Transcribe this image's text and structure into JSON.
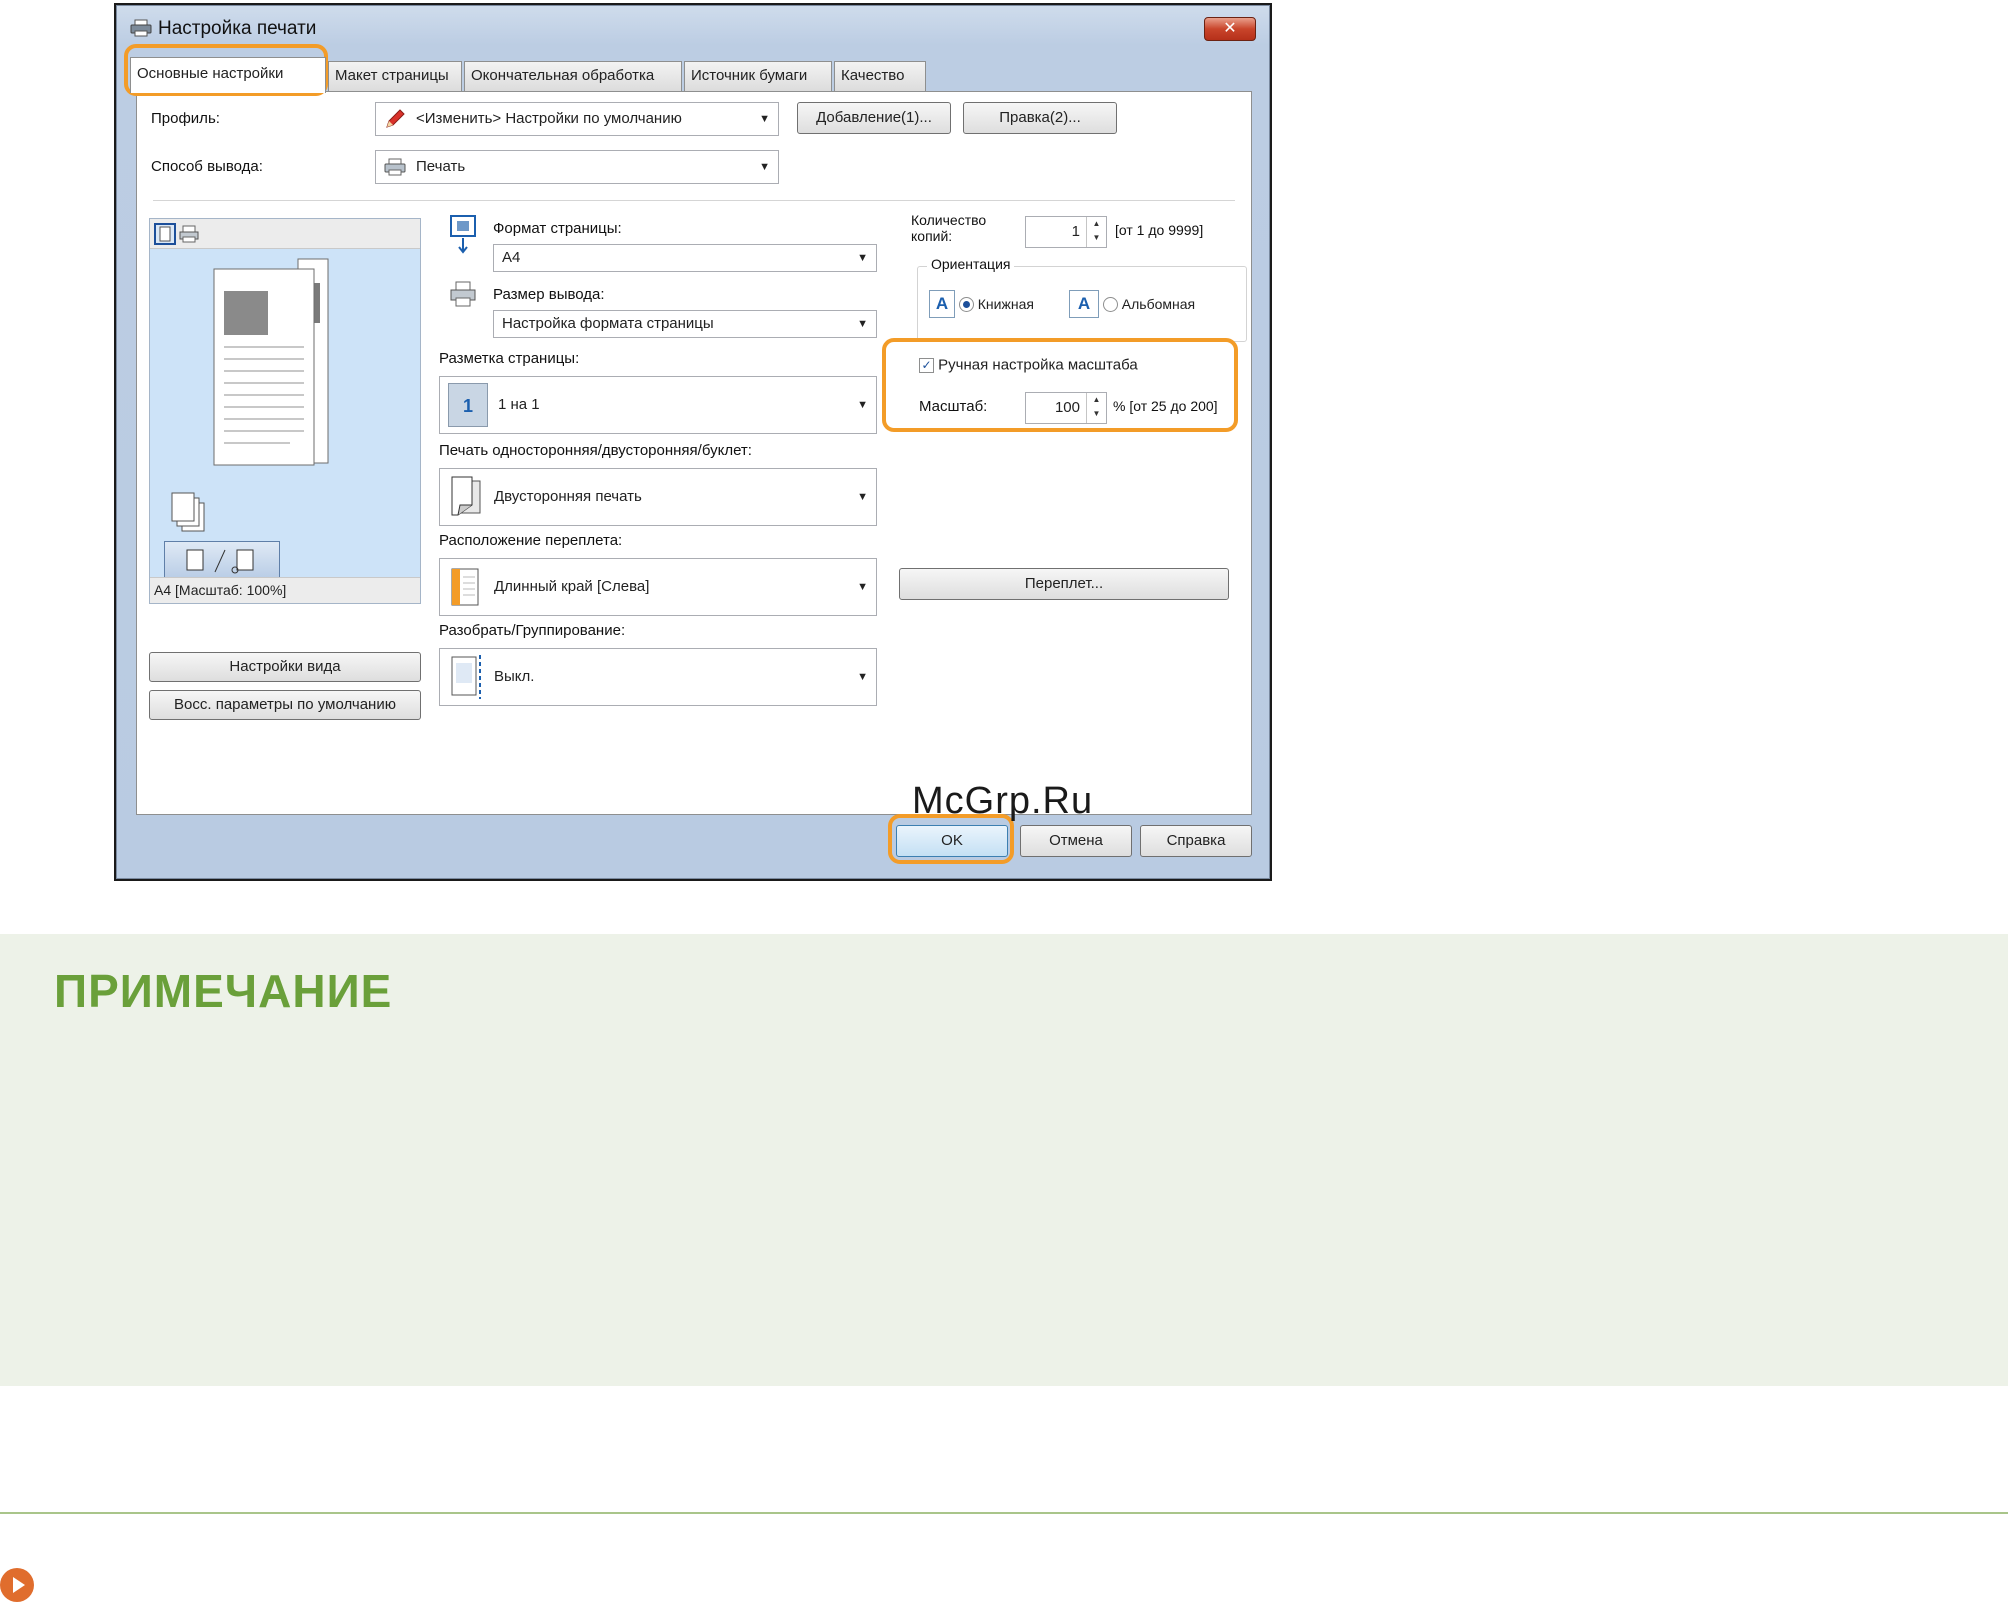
{
  "dialog": {
    "title": "Настройка печати",
    "close_glyph": "✕"
  },
  "tabs": [
    {
      "label": "Основные настройки"
    },
    {
      "label": "Макет страницы"
    },
    {
      "label": "Окончательная обработка"
    },
    {
      "label": "Источник бумаги"
    },
    {
      "label": "Качество"
    }
  ],
  "profile": {
    "label": "Профиль:",
    "value": "<Изменить> Настройки по умолчанию",
    "add_button": "Добавление(1)...",
    "edit_button": "Правка(2)..."
  },
  "output_method": {
    "label": "Способ вывода:",
    "value": "Печать"
  },
  "preview": {
    "status": "A4 [Масштаб: 100%]",
    "view_settings_button": "Настройки вида",
    "restore_defaults_button": "Восс. параметры по умолчанию"
  },
  "page_size": {
    "label": "Формат страницы:",
    "value": "A4"
  },
  "output_size": {
    "label": "Размер вывода:",
    "value": "Настройка формата страницы"
  },
  "page_layout": {
    "label": "Разметка страницы:",
    "value": "1 на 1",
    "icon_text": "1"
  },
  "duplex": {
    "label": "Печать односторонняя/двусторонняя/буклет:",
    "value": "Двусторонняя печать"
  },
  "binding_location": {
    "label": "Расположение переплета:",
    "value": "Длинный край [Слева]"
  },
  "collate": {
    "label": "Разобрать/Группирование:",
    "value": "Выкл."
  },
  "copies": {
    "label_line1": "Количество",
    "label_line2": "копий:",
    "value": "1",
    "range": "[от 1 до 9999]"
  },
  "orientation": {
    "label": "Ориентация",
    "portrait": "Книжная",
    "landscape": "Альбомная",
    "icon_letter": "A",
    "selected": "portrait"
  },
  "scaling": {
    "checkbox_label": "Ручная настройка масштаба",
    "checked": true,
    "check_glyph": "✓",
    "label": "Масштаб:",
    "value": "100",
    "range": "% [от 25 до 200]"
  },
  "binding_button": "Переплет...",
  "footer": {
    "ok": "OK",
    "cancel": "Отмена",
    "help": "Справка"
  },
  "watermark": "McGrp.Ru",
  "note": {
    "title": "ПРИМЕЧАНИЕ"
  },
  "colors": {
    "highlight": "#f39c28",
    "note_title": "#6aa03a",
    "note_bg": "#edf2e8"
  }
}
